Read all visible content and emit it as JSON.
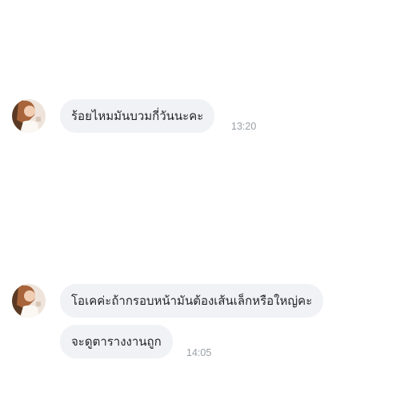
{
  "messages": [
    {
      "text": "ร้อยไหมมันบวมกี่วันนะคะ",
      "time": "13:20"
    },
    {
      "text": "โอเคค่ะถ้ากรอบหน้ามันต้องเส้นเล็กหรือใหญ่คะ",
      "time": ""
    },
    {
      "text": "จะดูตารางงานถูก",
      "time": "14:05"
    }
  ],
  "colors": {
    "bubble": "#f1f2f6",
    "text": "#1f2328",
    "time": "#9aa0a6"
  },
  "icons": {
    "avatar": "user-photo-avatar"
  }
}
